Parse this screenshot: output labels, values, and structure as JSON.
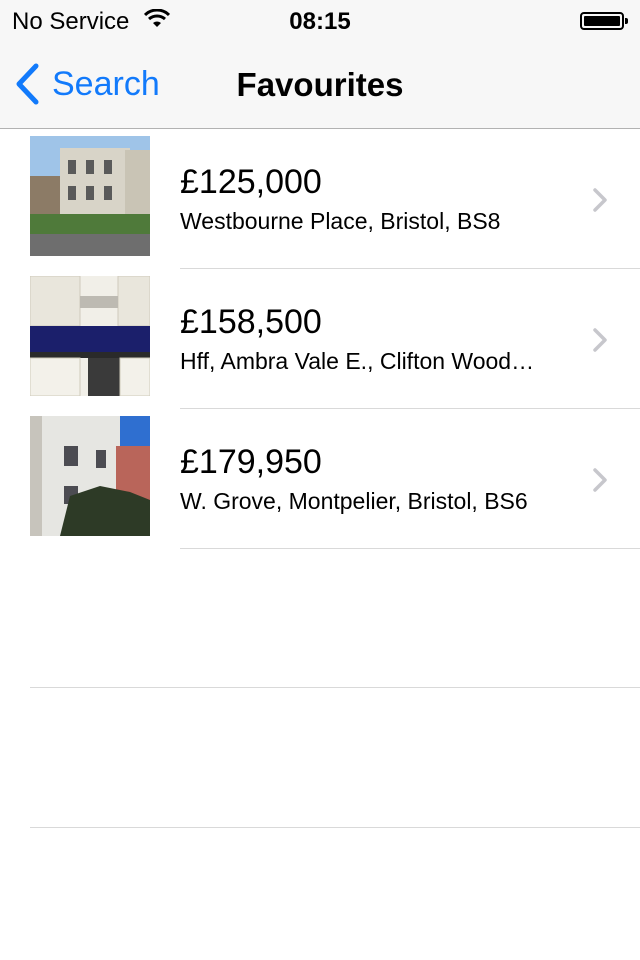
{
  "status_bar": {
    "carrier": "No Service",
    "time": "08:15",
    "wifi_icon": "wifi-icon",
    "battery_icon": "battery-icon"
  },
  "nav": {
    "back_label": "Search",
    "title": "Favourites",
    "accent_color": "#127afb"
  },
  "listings": [
    {
      "price": "£125,000",
      "address": "Westbourne Place, Bristol, BS8",
      "image": "house-photo-thumbnail"
    },
    {
      "price": "£158,500",
      "address": "Hff, Ambra Vale E., Clifton Wood…",
      "image": "kitchen-photo-thumbnail"
    },
    {
      "price": "£179,950",
      "address": "W. Grove, Montpelier, Bristol, BS6",
      "image": "terrace-photo-thumbnail"
    }
  ]
}
